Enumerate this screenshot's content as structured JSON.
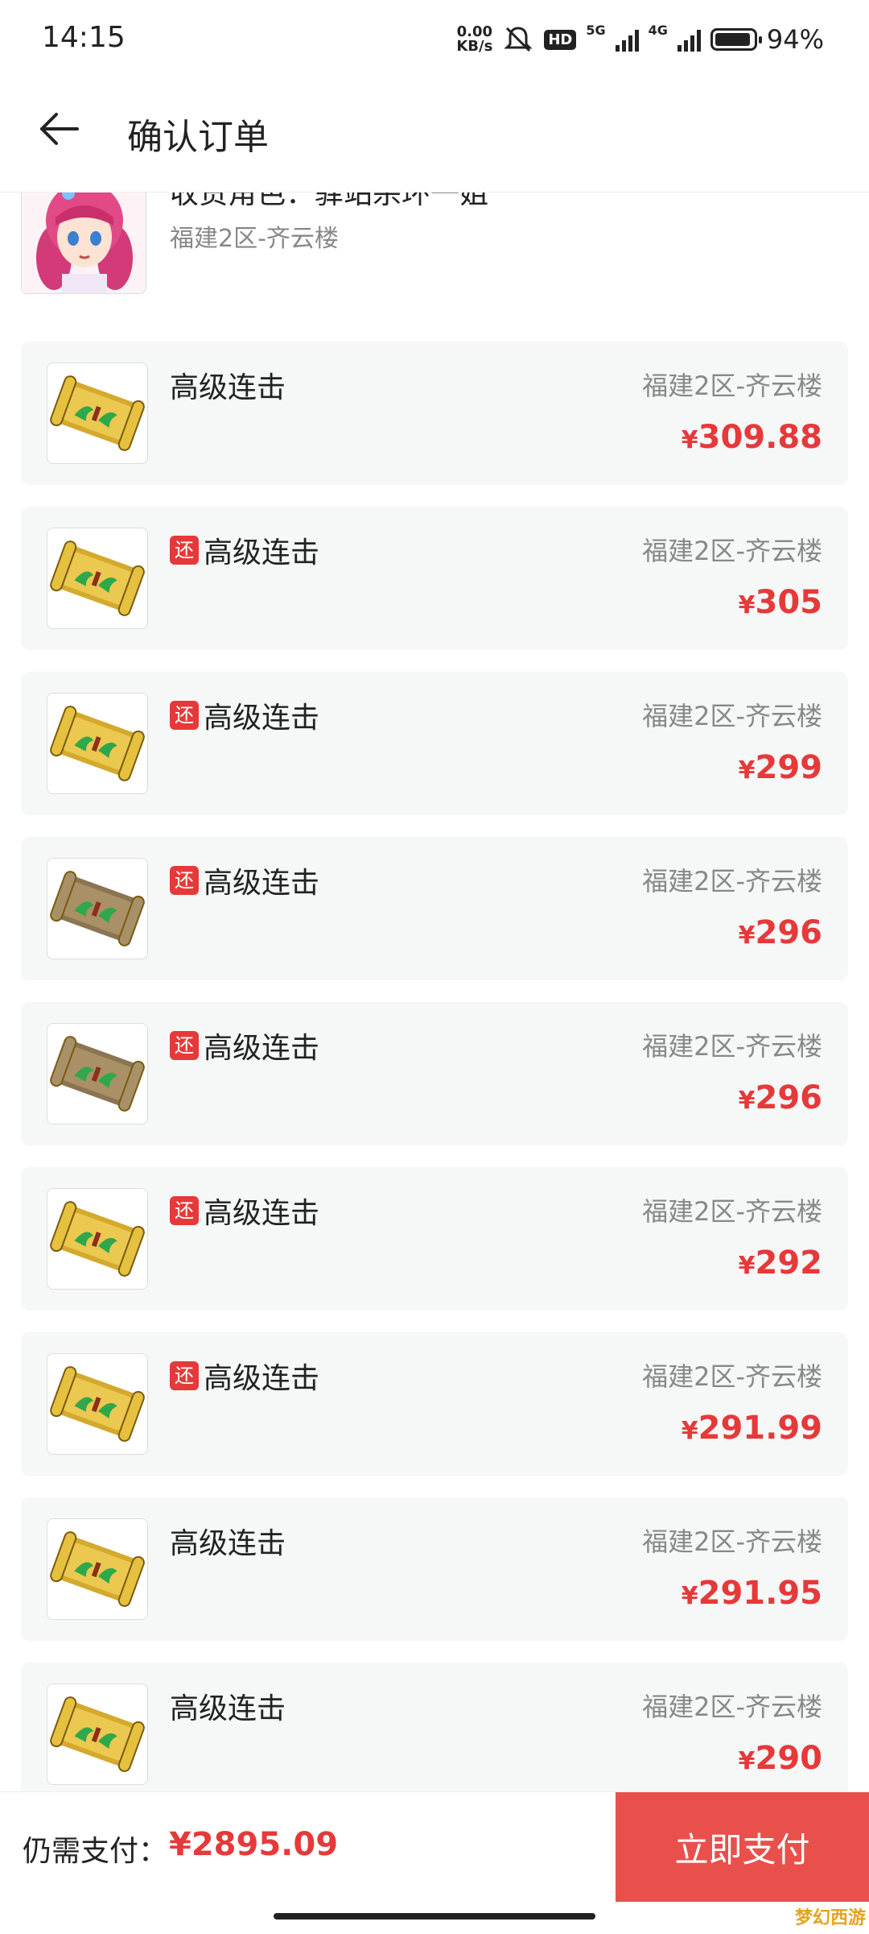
{
  "status_bar": {
    "time": "14:15",
    "net_speed_value": "0.00",
    "net_speed_unit": "KB/s",
    "hd_label": "HD",
    "net1": "5G",
    "net2": "4G",
    "battery": "94%",
    "battery_level": 0.94,
    "icons": [
      "mute-icon",
      "signal-icon",
      "battery-icon"
    ]
  },
  "header": {
    "title": "确认订单",
    "back_icon": "arrow-left-icon"
  },
  "receiver": {
    "label": "收货角色：驿站杀环一姐",
    "server": "福建2区-齐云楼"
  },
  "items": [
    {
      "name": "高级连击",
      "server": "福建2区-齐云楼",
      "price": "309.88",
      "return_tag": false,
      "scroll": "gold"
    },
    {
      "name": "高级连击",
      "server": "福建2区-齐云楼",
      "price": "305",
      "return_tag": true,
      "tag": "还",
      "scroll": "gold"
    },
    {
      "name": "高级连击",
      "server": "福建2区-齐云楼",
      "price": "299",
      "return_tag": true,
      "tag": "还",
      "scroll": "gold"
    },
    {
      "name": "高级连击",
      "server": "福建2区-齐云楼",
      "price": "296",
      "return_tag": true,
      "tag": "还",
      "scroll": "brown"
    },
    {
      "name": "高级连击",
      "server": "福建2区-齐云楼",
      "price": "296",
      "return_tag": true,
      "tag": "还",
      "scroll": "brown"
    },
    {
      "name": "高级连击",
      "server": "福建2区-齐云楼",
      "price": "292",
      "return_tag": true,
      "tag": "还",
      "scroll": "gold"
    },
    {
      "name": "高级连击",
      "server": "福建2区-齐云楼",
      "price": "291.99",
      "return_tag": true,
      "tag": "还",
      "scroll": "gold"
    },
    {
      "name": "高级连击",
      "server": "福建2区-齐云楼",
      "price": "291.95",
      "return_tag": false,
      "scroll": "gold"
    },
    {
      "name": "高级连击",
      "server": "福建2区-齐云楼",
      "price": "290",
      "return_tag": false,
      "scroll": "gold"
    }
  ],
  "currency": "¥",
  "footer": {
    "due_label": "仍需支付：",
    "due_amount": "¥2895.09",
    "pay_button": "立即支付",
    "watermark": "梦幻西游"
  },
  "colors": {
    "accent": "#e6393a",
    "pay_button": "#e9504c",
    "card_bg": "#f6f7f7"
  }
}
